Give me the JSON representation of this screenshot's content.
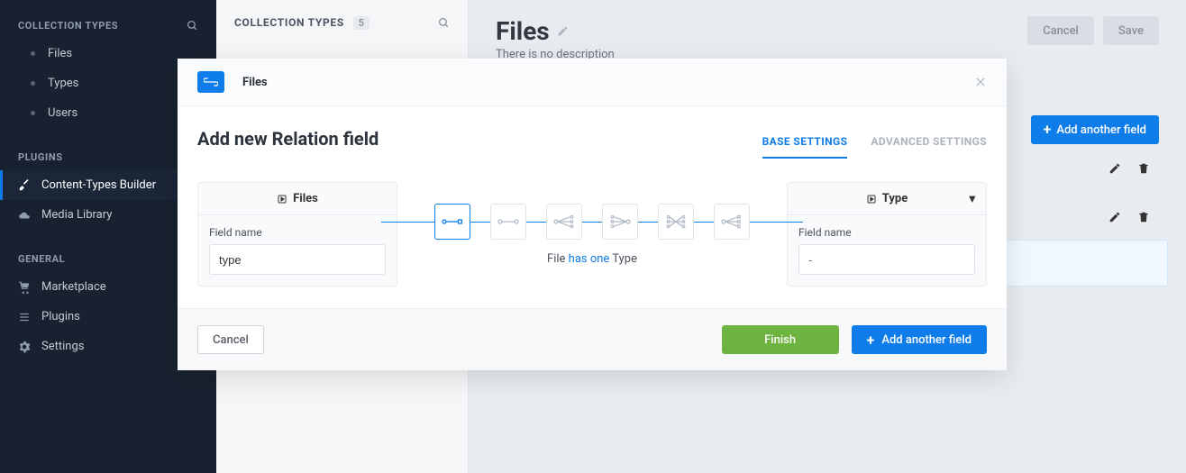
{
  "sidebar": {
    "sections": {
      "collection_types": "COLLECTION TYPES",
      "plugins": "PLUGINS",
      "general": "GENERAL"
    },
    "collectionItems": [
      "Files",
      "Types",
      "Users"
    ],
    "pluginItems": [
      "Content-Types Builder",
      "Media Library"
    ],
    "generalItems": [
      "Marketplace",
      "Plugins",
      "Settings"
    ]
  },
  "panel2": {
    "title": "COLLECTION TYPES",
    "count": "5"
  },
  "main": {
    "title": "Files",
    "description": "There is no description",
    "cancel": "Cancel",
    "save": "Save",
    "add_another_field": "Add another field"
  },
  "modal": {
    "breadcrumb": "Files",
    "title": "Add new Relation field",
    "tab_base": "BASE SETTINGS",
    "tab_advanced": "ADVANCED SETTINGS",
    "left_card_title": "Files",
    "right_card_title": "Type",
    "field_name_label": "Field name",
    "left_field_value": "type",
    "right_field_placeholder": "-",
    "caption_entity": "File",
    "caption_relation": "has one",
    "caption_target": "Type",
    "cancel": "Cancel",
    "finish": "Finish",
    "add_another_field": "Add another field"
  }
}
